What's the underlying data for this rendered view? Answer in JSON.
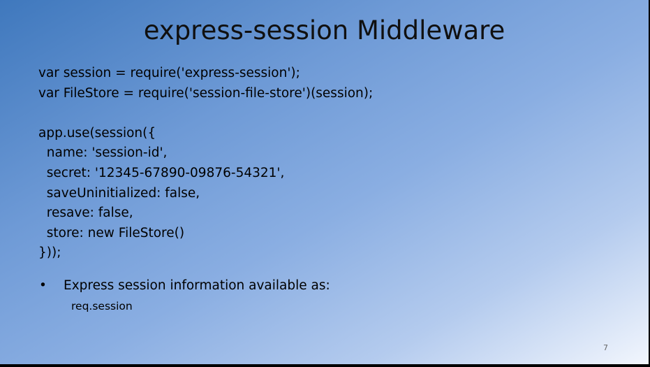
{
  "slide": {
    "title": "express-session Middleware",
    "code_lines": [
      "var session = require('express-session');",
      "var FileStore = require('session-file-store')(session);",
      "",
      "app.use(session({",
      "  name: 'session-id',",
      "  secret: '12345-67890-09876-54321',",
      "  saveUninitialized: false,",
      "  resave: false,",
      "  store: new FileStore()",
      "}));"
    ],
    "bullet": {
      "glyph": "•",
      "text": "Express session information available as:",
      "sub_text": "req.session"
    },
    "page_number": "7"
  }
}
